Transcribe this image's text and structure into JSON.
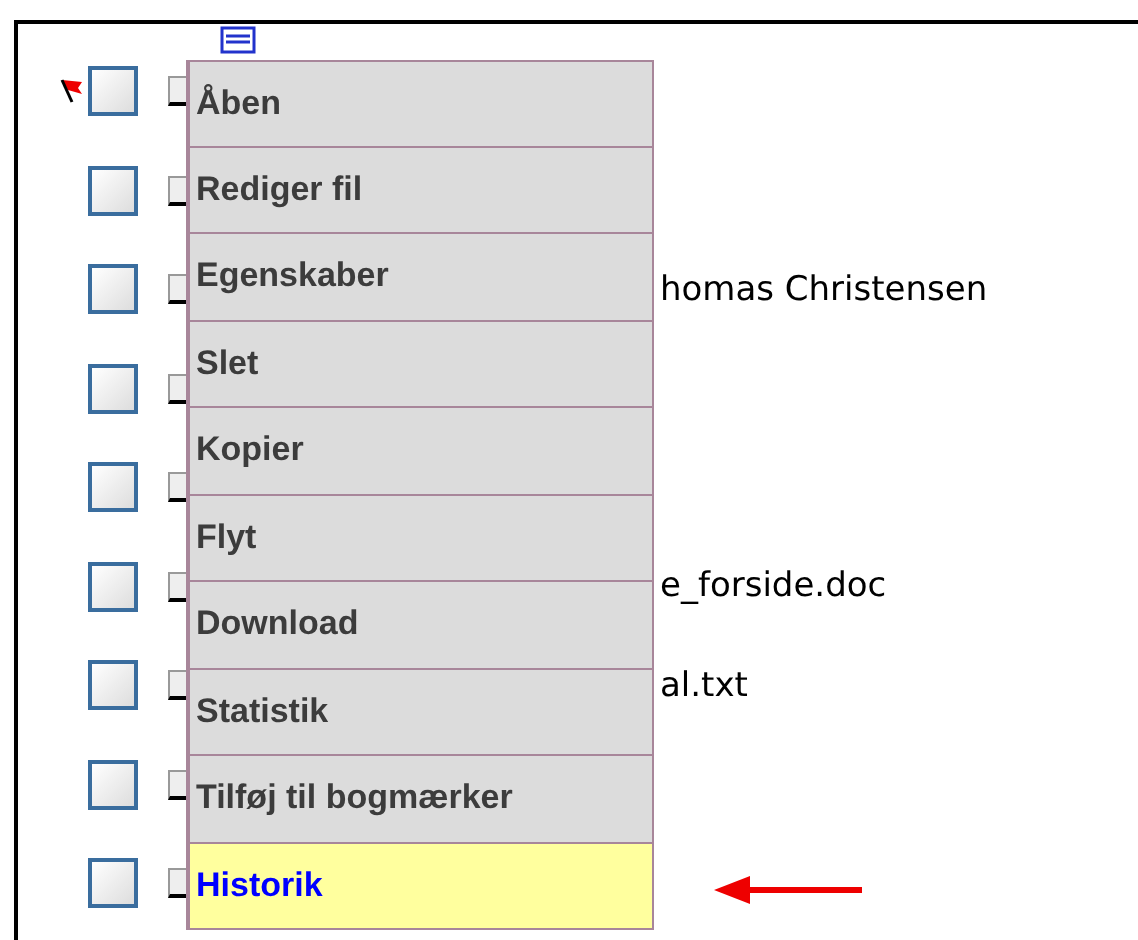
{
  "tree": {
    "rows": [
      {
        "flagged": true,
        "checked": false
      },
      {
        "flagged": false,
        "checked": false
      },
      {
        "flagged": false,
        "checked": false,
        "label": "homas Christensen"
      },
      {
        "flagged": false,
        "checked": false
      },
      {
        "flagged": false,
        "checked": false
      },
      {
        "flagged": false,
        "checked": false,
        "label": "e_forside.doc"
      },
      {
        "flagged": false,
        "checked": false,
        "label": "al.txt"
      },
      {
        "flagged": false,
        "checked": false
      },
      {
        "flagged": false,
        "checked": false
      }
    ]
  },
  "context_menu": {
    "items": [
      {
        "label": "Åben",
        "selected": false
      },
      {
        "label": "Rediger fil",
        "selected": false
      },
      {
        "label": "Egenskaber",
        "selected": false
      },
      {
        "label": "Slet",
        "selected": false
      },
      {
        "label": "Kopier",
        "selected": false
      },
      {
        "label": "Flyt",
        "selected": false
      },
      {
        "label": "Download",
        "selected": false
      },
      {
        "label": "Statistik",
        "selected": false
      },
      {
        "label": "Tilføj til bogmærker",
        "selected": false
      },
      {
        "label": "Historik",
        "selected": true
      }
    ]
  }
}
